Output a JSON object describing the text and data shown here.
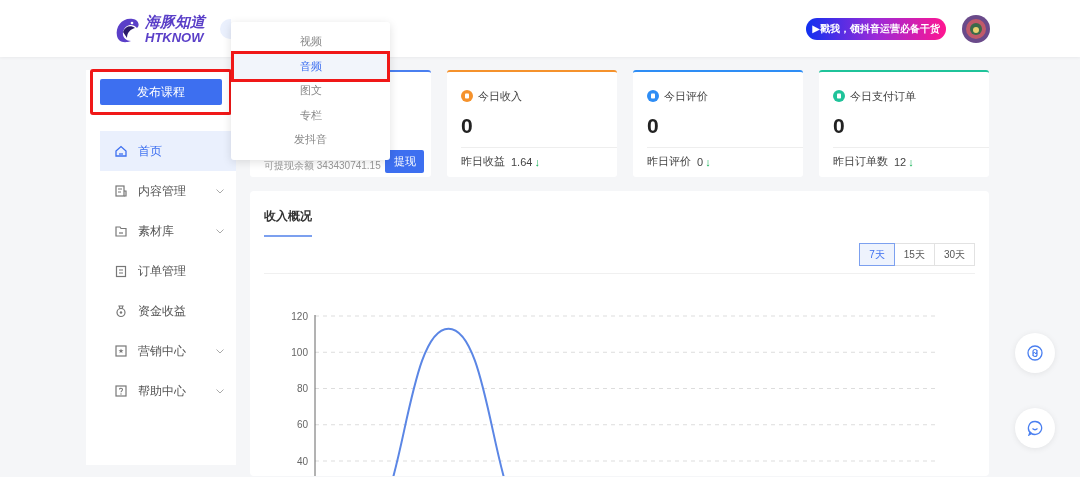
{
  "header": {
    "logo_title": "海豚知道",
    "logo_subtitle": "HTKNOW",
    "promo": "▶戳我，领抖音运营必备干货"
  },
  "publish_button": {
    "label": "发布课程",
    "highlighted": true
  },
  "publish_menu": {
    "items": [
      {
        "label": "视频",
        "selected": false,
        "highlighted": false
      },
      {
        "label": "音频",
        "selected": true,
        "highlighted": true
      },
      {
        "label": "图文",
        "selected": false,
        "highlighted": false
      },
      {
        "label": "专栏",
        "selected": false,
        "highlighted": false
      },
      {
        "label": "发抖音",
        "selected": false,
        "highlighted": false
      }
    ]
  },
  "sidebar": {
    "items": [
      {
        "label": "首页",
        "selected": true,
        "has_submenu": false
      },
      {
        "label": "内容管理",
        "selected": false,
        "has_submenu": true
      },
      {
        "label": "素材库",
        "selected": false,
        "has_submenu": true
      },
      {
        "label": "订单管理",
        "selected": false,
        "has_submenu": false
      },
      {
        "label": "资金收益",
        "selected": false,
        "has_submenu": false
      },
      {
        "label": "营销中心",
        "selected": false,
        "has_submenu": true
      },
      {
        "label": "帮助中心",
        "selected": false,
        "has_submenu": true
      }
    ]
  },
  "withdraw_card": {
    "color": "#4a7ff0",
    "balance_text": "可提现余额 343430741.15",
    "button": "提现"
  },
  "stat_cards": [
    {
      "title": "今日收入",
      "value": "0",
      "footer_label": "昨日收益",
      "footer_value": "1.64",
      "trend": "↓",
      "color": "#f5922c"
    },
    {
      "title": "今日评价",
      "value": "0",
      "footer_label": "昨日评价",
      "footer_value": "0",
      "trend": "↓",
      "color": "#2e8df5"
    },
    {
      "title": "今日支付订单",
      "value": "0",
      "footer_label": "昨日订单数",
      "footer_value": "12",
      "trend": "↓",
      "color": "#1fc39a"
    }
  ],
  "income_panel": {
    "title": "收入概况",
    "ranges": [
      {
        "label": "7天",
        "selected": true
      },
      {
        "label": "15天",
        "selected": false
      },
      {
        "label": "30天",
        "selected": false
      }
    ],
    "chart_data": {
      "type": "line",
      "ylim": [
        0,
        120
      ],
      "yticks": [
        40,
        60,
        80,
        100,
        120
      ],
      "grid": true,
      "series": [
        {
          "color": "#5b86e5",
          "values": [
            0,
            113,
            0,
            null,
            null,
            null,
            null
          ]
        }
      ]
    }
  }
}
